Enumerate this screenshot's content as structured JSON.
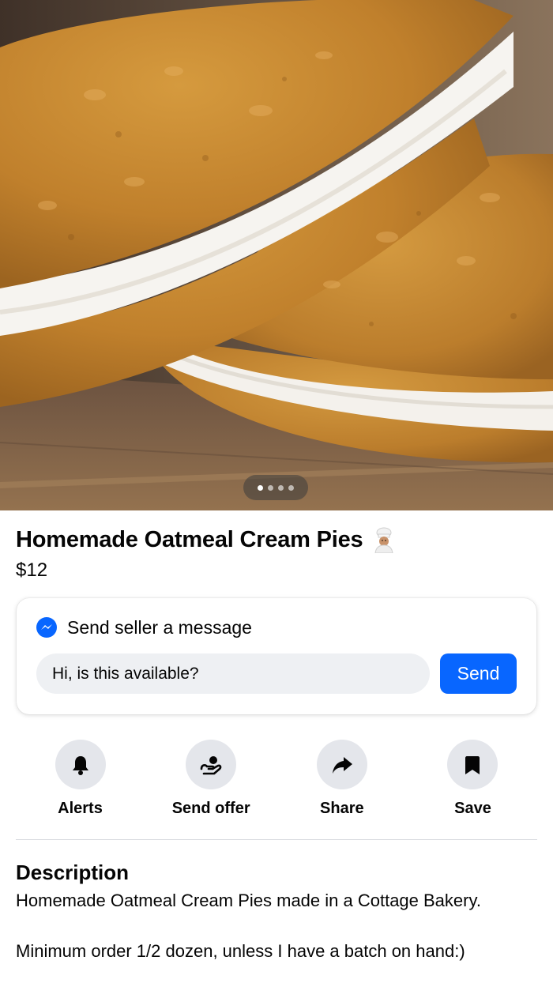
{
  "photo": {
    "pager_count": 4,
    "pager_active_index": 0
  },
  "listing": {
    "title": "Homemade Oatmeal Cream Pies",
    "title_emoji": "chef-icon",
    "price": "$12"
  },
  "message": {
    "heading": "Send seller a message",
    "input_value": "Hi, is this available?",
    "send_label": "Send"
  },
  "actions": [
    {
      "label": "Alerts",
      "icon": "bell-icon"
    },
    {
      "label": "Send offer",
      "icon": "offer-icon"
    },
    {
      "label": "Share",
      "icon": "share-arrow-icon"
    },
    {
      "label": "Save",
      "icon": "bookmark-icon"
    }
  ],
  "description": {
    "heading": "Description",
    "line1": "Homemade Oatmeal Cream Pies made in a Cottage Bakery.",
    "line2": "Minimum order 1/2 dozen, unless I have a batch on hand:)"
  },
  "colors": {
    "accent": "#0866ff",
    "icon_bg": "#e4e6eb",
    "input_bg": "#eef0f3"
  }
}
